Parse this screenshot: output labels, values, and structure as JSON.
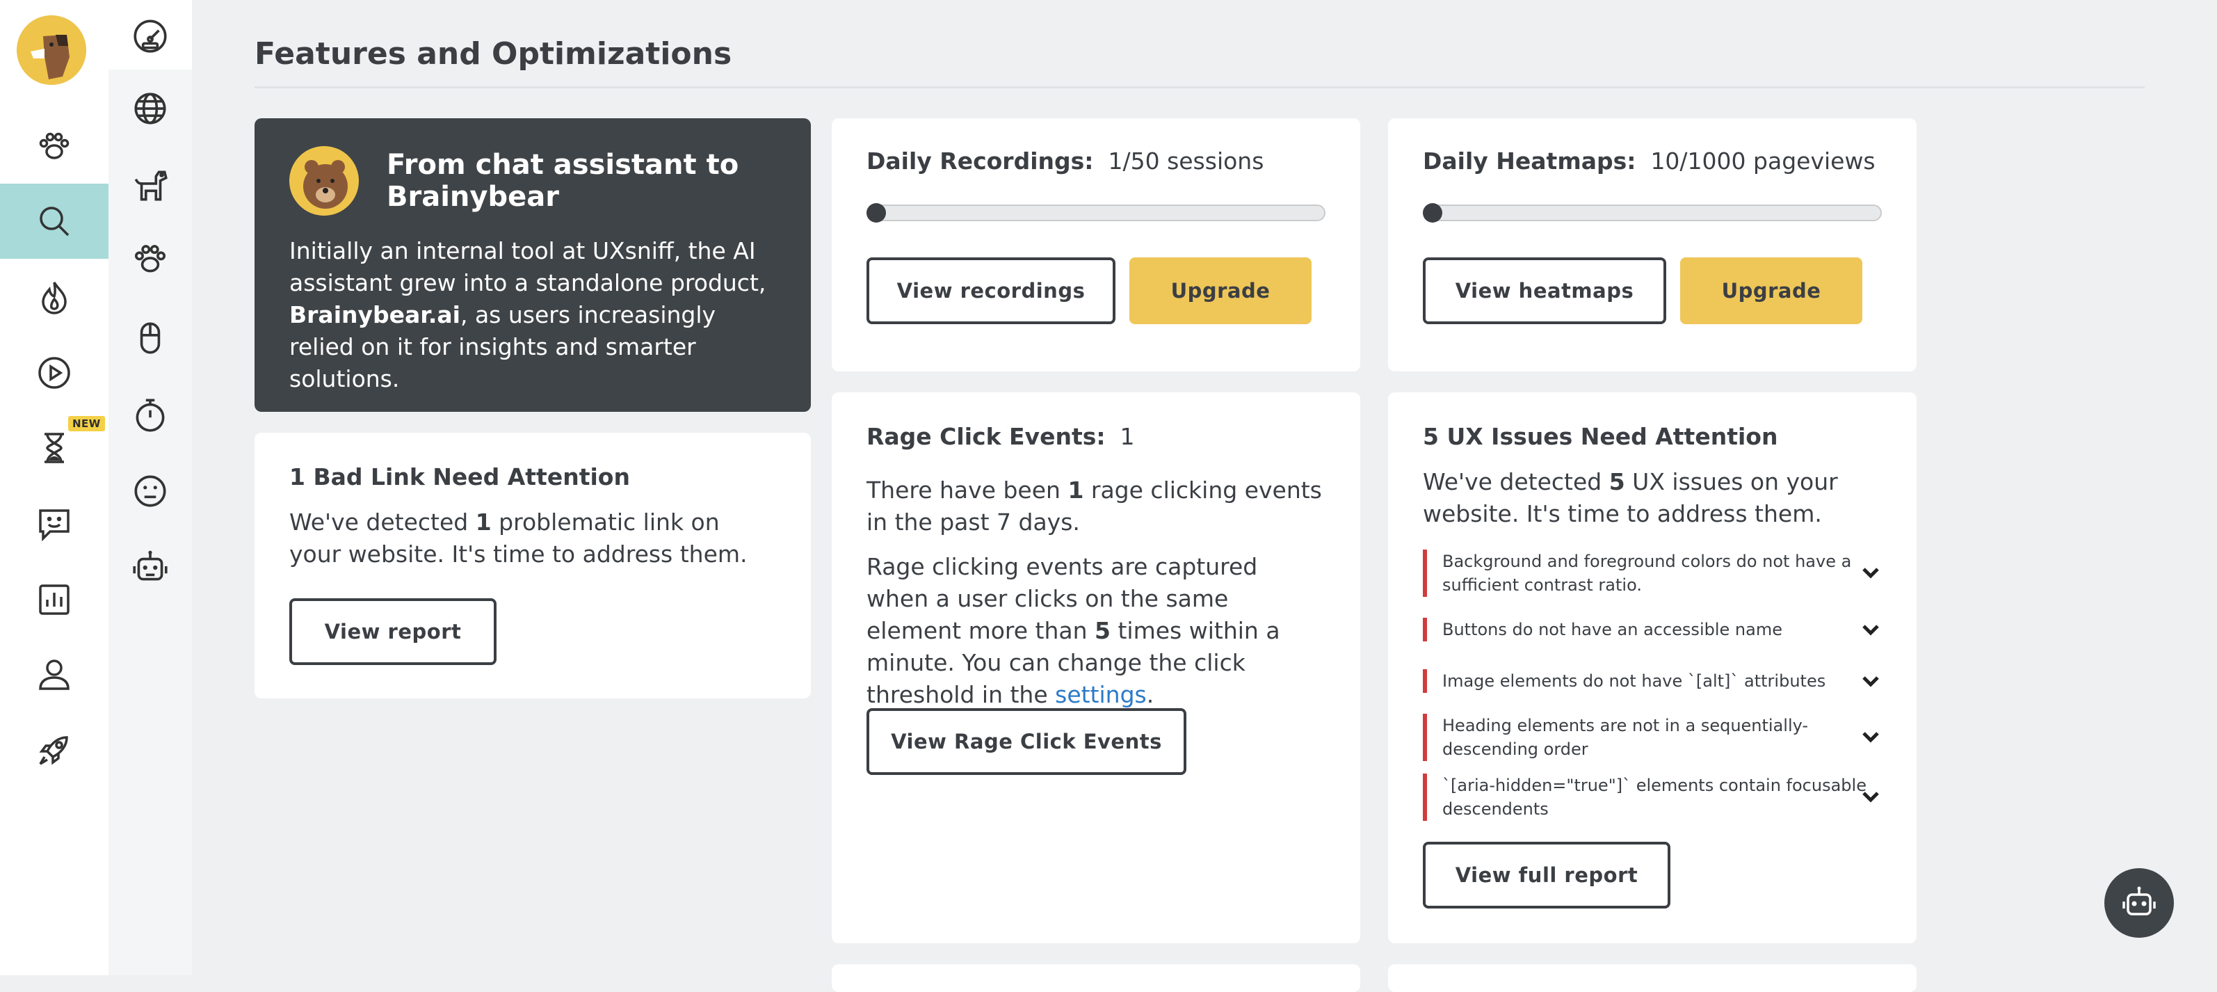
{
  "page": {
    "title": "Features and Optimizations"
  },
  "sidebar": {
    "primary": [
      "paw-icon",
      "search-icon",
      "fire-icon",
      "play-icon",
      "hourglass-icon",
      "chat-icon",
      "bar-chart-icon",
      "user-icon",
      "rocket-icon"
    ],
    "new_badge": "NEW",
    "secondary": [
      "dashboard-icon",
      "globe-icon",
      "dog-icon",
      "paw-icon",
      "mouse-icon",
      "stopwatch-icon",
      "face-icon",
      "robot-icon"
    ]
  },
  "promo": {
    "title": "From chat assistant to Brainybear",
    "text_pre": "Initially an internal tool at UXsniff, the AI assistant grew into a standalone product, ",
    "brand": "Brainybear.ai",
    "text_post": ", as users increasingly relied on it for insights and smarter solutions."
  },
  "recordings": {
    "label": "Daily Recordings:",
    "value": "1/50 sessions",
    "progress": 0.02,
    "view_button": "View recordings",
    "upgrade_button": "Upgrade"
  },
  "heatmaps": {
    "label": "Daily Heatmaps:",
    "value": "10/1000 pageviews",
    "progress": 0.01,
    "view_button": "View heatmaps",
    "upgrade_button": "Upgrade"
  },
  "bad_link": {
    "title": "1 Bad Link Need Attention",
    "text_pre": "We've detected ",
    "count": "1",
    "text_post": " problematic link on your website. It's time to address them.",
    "button": "View report"
  },
  "rage": {
    "label": "Rage Click Events:",
    "value": "1",
    "p1_pre": "There have been ",
    "p1_count": "1",
    "p1_post": " rage clicking events in the past 7 days.",
    "p2_pre": "Rage clicking events are captured when a user clicks on the same element more than ",
    "p2_count": "5",
    "p2_mid": " times within a minute. You can change the click threshold in the ",
    "p2_link": "settings",
    "p2_end": ".",
    "button": "View Rage Click Events"
  },
  "ux": {
    "title": "5 UX Issues Need Attention",
    "text_pre": "We've detected ",
    "count": "5",
    "text_post": " UX issues on your website. It's time to address them.",
    "issues": [
      "Background and foreground colors do not have a sufficient contrast ratio.",
      "Buttons do not have an accessible name",
      "Image elements do not have `[alt]` attributes",
      "Heading elements are not in a sequentially-descending order",
      "`[aria-hidden=\"true\"]` elements contain focusable descendents"
    ],
    "button": "View full report"
  },
  "colors": {
    "accent_yellow": "#efc658",
    "active_teal": "#a7dad9",
    "issue_red": "#d23b3b",
    "dark_card": "#3f4448",
    "link_blue": "#2a7ac8"
  }
}
